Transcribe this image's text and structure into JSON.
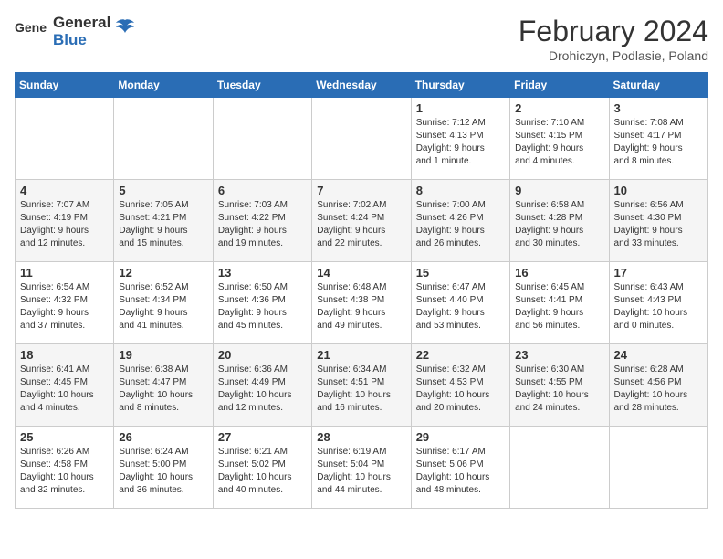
{
  "logo": {
    "general": "General",
    "blue": "Blue"
  },
  "title": "February 2024",
  "subtitle": "Drohiczyn, Podlasie, Poland",
  "days_of_week": [
    "Sunday",
    "Monday",
    "Tuesday",
    "Wednesday",
    "Thursday",
    "Friday",
    "Saturday"
  ],
  "weeks": [
    [
      {
        "day": "",
        "info": ""
      },
      {
        "day": "",
        "info": ""
      },
      {
        "day": "",
        "info": ""
      },
      {
        "day": "",
        "info": ""
      },
      {
        "day": "1",
        "info": "Sunrise: 7:12 AM\nSunset: 4:13 PM\nDaylight: 9 hours\nand 1 minute."
      },
      {
        "day": "2",
        "info": "Sunrise: 7:10 AM\nSunset: 4:15 PM\nDaylight: 9 hours\nand 4 minutes."
      },
      {
        "day": "3",
        "info": "Sunrise: 7:08 AM\nSunset: 4:17 PM\nDaylight: 9 hours\nand 8 minutes."
      }
    ],
    [
      {
        "day": "4",
        "info": "Sunrise: 7:07 AM\nSunset: 4:19 PM\nDaylight: 9 hours\nand 12 minutes."
      },
      {
        "day": "5",
        "info": "Sunrise: 7:05 AM\nSunset: 4:21 PM\nDaylight: 9 hours\nand 15 minutes."
      },
      {
        "day": "6",
        "info": "Sunrise: 7:03 AM\nSunset: 4:22 PM\nDaylight: 9 hours\nand 19 minutes."
      },
      {
        "day": "7",
        "info": "Sunrise: 7:02 AM\nSunset: 4:24 PM\nDaylight: 9 hours\nand 22 minutes."
      },
      {
        "day": "8",
        "info": "Sunrise: 7:00 AM\nSunset: 4:26 PM\nDaylight: 9 hours\nand 26 minutes."
      },
      {
        "day": "9",
        "info": "Sunrise: 6:58 AM\nSunset: 4:28 PM\nDaylight: 9 hours\nand 30 minutes."
      },
      {
        "day": "10",
        "info": "Sunrise: 6:56 AM\nSunset: 4:30 PM\nDaylight: 9 hours\nand 33 minutes."
      }
    ],
    [
      {
        "day": "11",
        "info": "Sunrise: 6:54 AM\nSunset: 4:32 PM\nDaylight: 9 hours\nand 37 minutes."
      },
      {
        "day": "12",
        "info": "Sunrise: 6:52 AM\nSunset: 4:34 PM\nDaylight: 9 hours\nand 41 minutes."
      },
      {
        "day": "13",
        "info": "Sunrise: 6:50 AM\nSunset: 4:36 PM\nDaylight: 9 hours\nand 45 minutes."
      },
      {
        "day": "14",
        "info": "Sunrise: 6:48 AM\nSunset: 4:38 PM\nDaylight: 9 hours\nand 49 minutes."
      },
      {
        "day": "15",
        "info": "Sunrise: 6:47 AM\nSunset: 4:40 PM\nDaylight: 9 hours\nand 53 minutes."
      },
      {
        "day": "16",
        "info": "Sunrise: 6:45 AM\nSunset: 4:41 PM\nDaylight: 9 hours\nand 56 minutes."
      },
      {
        "day": "17",
        "info": "Sunrise: 6:43 AM\nSunset: 4:43 PM\nDaylight: 10 hours\nand 0 minutes."
      }
    ],
    [
      {
        "day": "18",
        "info": "Sunrise: 6:41 AM\nSunset: 4:45 PM\nDaylight: 10 hours\nand 4 minutes."
      },
      {
        "day": "19",
        "info": "Sunrise: 6:38 AM\nSunset: 4:47 PM\nDaylight: 10 hours\nand 8 minutes."
      },
      {
        "day": "20",
        "info": "Sunrise: 6:36 AM\nSunset: 4:49 PM\nDaylight: 10 hours\nand 12 minutes."
      },
      {
        "day": "21",
        "info": "Sunrise: 6:34 AM\nSunset: 4:51 PM\nDaylight: 10 hours\nand 16 minutes."
      },
      {
        "day": "22",
        "info": "Sunrise: 6:32 AM\nSunset: 4:53 PM\nDaylight: 10 hours\nand 20 minutes."
      },
      {
        "day": "23",
        "info": "Sunrise: 6:30 AM\nSunset: 4:55 PM\nDaylight: 10 hours\nand 24 minutes."
      },
      {
        "day": "24",
        "info": "Sunrise: 6:28 AM\nSunset: 4:56 PM\nDaylight: 10 hours\nand 28 minutes."
      }
    ],
    [
      {
        "day": "25",
        "info": "Sunrise: 6:26 AM\nSunset: 4:58 PM\nDaylight: 10 hours\nand 32 minutes."
      },
      {
        "day": "26",
        "info": "Sunrise: 6:24 AM\nSunset: 5:00 PM\nDaylight: 10 hours\nand 36 minutes."
      },
      {
        "day": "27",
        "info": "Sunrise: 6:21 AM\nSunset: 5:02 PM\nDaylight: 10 hours\nand 40 minutes."
      },
      {
        "day": "28",
        "info": "Sunrise: 6:19 AM\nSunset: 5:04 PM\nDaylight: 10 hours\nand 44 minutes."
      },
      {
        "day": "29",
        "info": "Sunrise: 6:17 AM\nSunset: 5:06 PM\nDaylight: 10 hours\nand 48 minutes."
      },
      {
        "day": "",
        "info": ""
      },
      {
        "day": "",
        "info": ""
      }
    ]
  ]
}
